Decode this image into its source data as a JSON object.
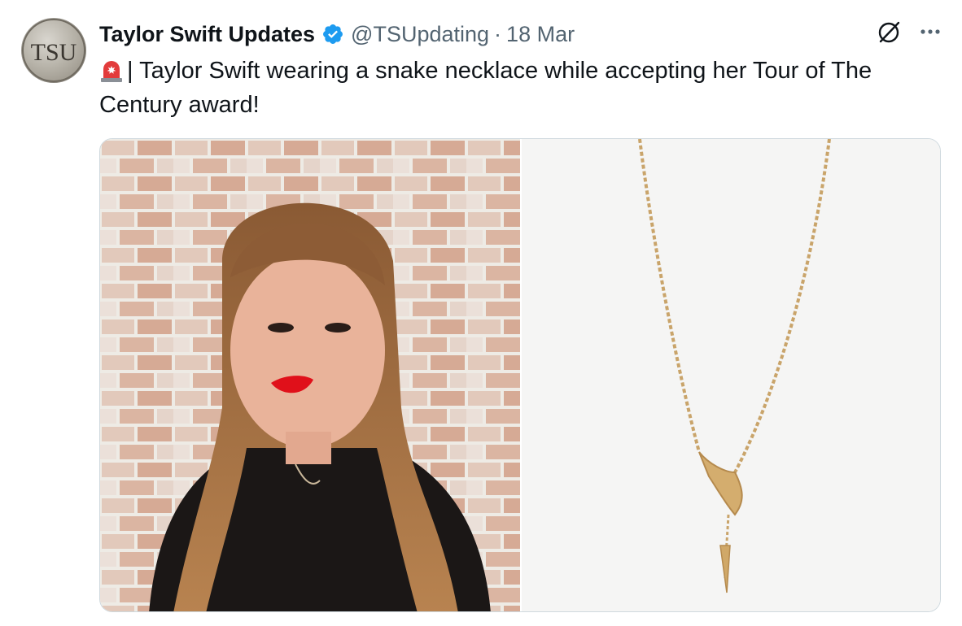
{
  "tweet": {
    "author": {
      "display_name": "Taylor Swift Updates",
      "handle": "@TSUpdating",
      "avatar_text": "TSU",
      "verified": true
    },
    "separator": "·",
    "date": "18 Mar",
    "text_emoji": "siren-emoji",
    "text": "| Taylor Swift wearing a snake necklace while accepting her Tour of The Century award!",
    "media": [
      {
        "alt": "Taylor Swift photo in front of a brick wall"
      },
      {
        "alt": "Gold snake necklace product photo"
      }
    ]
  },
  "colors": {
    "text": "#0f1419",
    "secondary": "#536471",
    "verified": "#1d9bf0",
    "border": "#cfd9de"
  },
  "icons": {
    "verified": "verified-badge-icon",
    "grok": "grok-icon",
    "more": "more-options-icon"
  }
}
